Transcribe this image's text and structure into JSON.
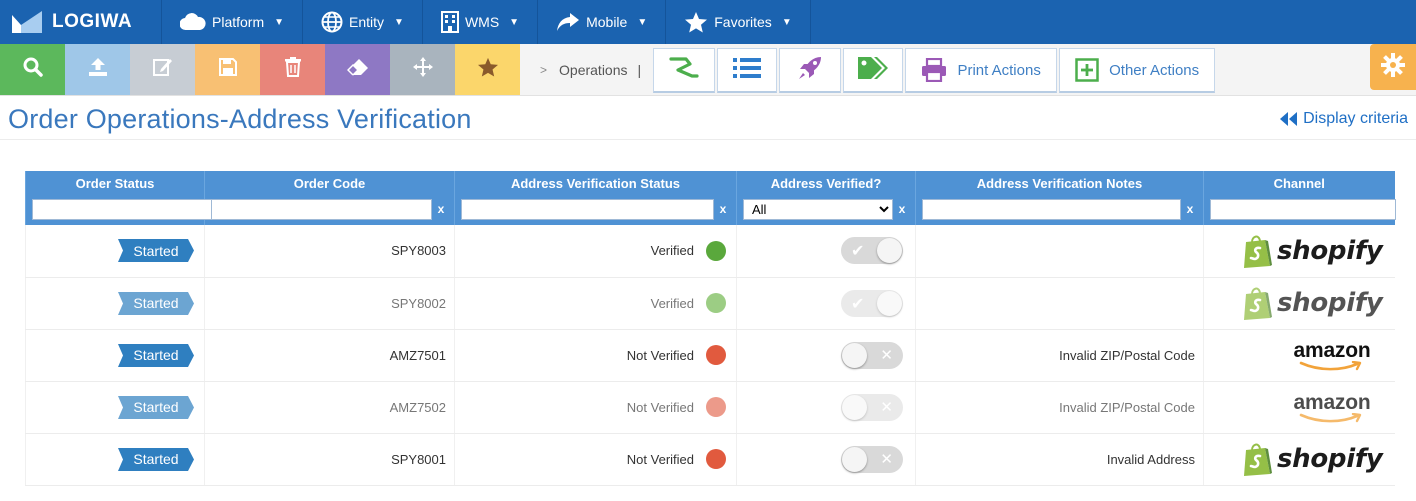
{
  "brand": {
    "name": "LOGIWA"
  },
  "nav": [
    {
      "label": "Platform",
      "icon": "cloud-icon"
    },
    {
      "label": "Entity",
      "icon": "globe-icon"
    },
    {
      "label": "WMS",
      "icon": "building-icon"
    },
    {
      "label": "Mobile",
      "icon": "share-arrow-icon"
    },
    {
      "label": "Favorites",
      "icon": "star-icon"
    }
  ],
  "toolbar": {
    "breadcrumb": "Operations",
    "breadcrumb_sep": "|",
    "print_actions": "Print Actions",
    "other_actions": "Other Actions",
    "colors": {
      "search": "#5cb85c",
      "upload": "#9fc7e8",
      "edit": "#c7cdd4",
      "save": "#f8c073",
      "delete": "#e8857a",
      "eraser": "#8e78c4",
      "move": "#a9b4be",
      "favorite": "#fbd66b"
    }
  },
  "page": {
    "title": "Order Operations-Address Verification",
    "display_criteria": "Display criteria"
  },
  "table": {
    "columns": [
      "Order Status",
      "Order Code",
      "Address Verification Status",
      "Address Verified?",
      "Address Verification Notes",
      "Channel"
    ],
    "filter_clear": "x",
    "verified_filter": {
      "selected": "All"
    },
    "rows": [
      {
        "status": "Started",
        "code": "SPY8003",
        "avs": "Verified",
        "dot": "#5aa83c",
        "verified": true,
        "notes": "",
        "channel": "shopify",
        "faded": false
      },
      {
        "status": "Started",
        "code": "SPY8002",
        "avs": "Verified",
        "dot": "#9ccd84",
        "verified": true,
        "notes": "",
        "channel": "shopify",
        "faded": true
      },
      {
        "status": "Started",
        "code": "AMZ7501",
        "avs": "Not Verified",
        "dot": "#e15a3e",
        "verified": false,
        "notes": "Invalid ZIP/Postal Code",
        "channel": "amazon",
        "faded": false
      },
      {
        "status": "Started",
        "code": "AMZ7502",
        "avs": "Not Verified",
        "dot": "#ec9a8a",
        "verified": false,
        "notes": "Invalid ZIP/Postal Code",
        "channel": "amazon",
        "faded": true
      },
      {
        "status": "Started",
        "code": "SPY8001",
        "avs": "Not Verified",
        "dot": "#e15a3e",
        "verified": false,
        "notes": "Invalid Address",
        "channel": "shopify",
        "faded": false
      }
    ]
  },
  "channels": {
    "shopify": "shopify",
    "amazon": "amazon"
  }
}
